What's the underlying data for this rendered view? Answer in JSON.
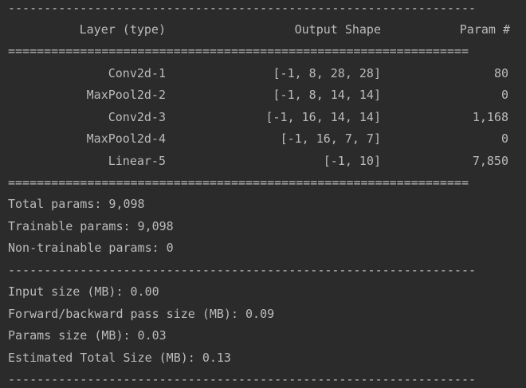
{
  "separators": {
    "dash": "-----------------------------------------------------------------",
    "equal": "================================================================"
  },
  "header": {
    "layer": "Layer (type)",
    "output": "Output Shape",
    "param": "Param #"
  },
  "layers": [
    {
      "name": "Conv2d-1",
      "shape": "[-1, 8, 28, 28]",
      "params": "80"
    },
    {
      "name": "MaxPool2d-2",
      "shape": "[-1, 8, 14, 14]",
      "params": "0"
    },
    {
      "name": "Conv2d-3",
      "shape": "[-1, 16, 14, 14]",
      "params": "1,168"
    },
    {
      "name": "MaxPool2d-4",
      "shape": "[-1, 16, 7, 7]",
      "params": "0"
    },
    {
      "name": "Linear-5",
      "shape": "[-1, 10]",
      "params": "7,850"
    }
  ],
  "totals": {
    "total": "Total params: 9,098",
    "trainable": "Trainable params: 9,098",
    "non_trainable": "Non-trainable params: 0"
  },
  "sizes": {
    "input": "Input size (MB): 0.00",
    "fwd_bwd": "Forward/backward pass size (MB): 0.09",
    "params": "Params size (MB): 0.03",
    "total": "Estimated Total Size (MB): 0.13"
  },
  "colors": {
    "background": "#2b2b2b",
    "text": "#bbbbbb"
  }
}
